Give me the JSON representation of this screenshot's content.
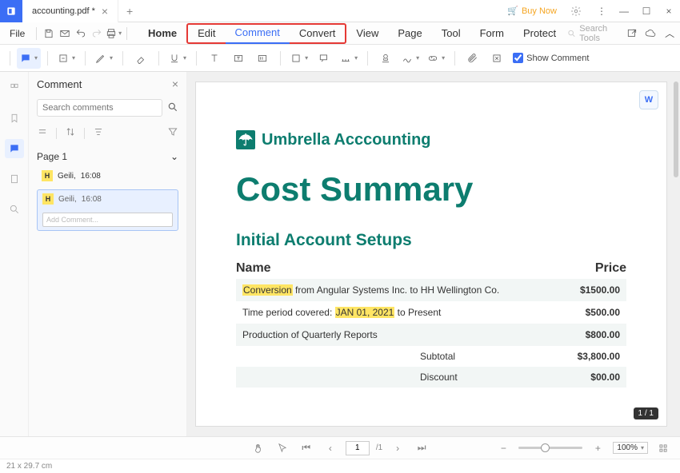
{
  "titlebar": {
    "filename": "accounting.pdf *",
    "buy_now": "Buy Now"
  },
  "menubar": {
    "file": "File",
    "tabs": [
      "Home",
      "Edit",
      "Comment",
      "Convert",
      "View",
      "Page",
      "Tool",
      "Form",
      "Protect"
    ],
    "search_placeholder": "Search Tools"
  },
  "toolbar": {
    "show_comment": "Show Comment"
  },
  "panel": {
    "title": "Comment",
    "search_placeholder": "Search comments",
    "page_label": "Page 1",
    "items": [
      {
        "author": "Geili,",
        "time": "16:08"
      },
      {
        "author": "Geili,",
        "time": "16:08"
      }
    ],
    "add_placeholder": "Add Comment..."
  },
  "document": {
    "brand": "Umbrella Acccounting",
    "title": "Cost Summary",
    "subtitle": "Initial Account Setups",
    "col_name": "Name",
    "col_price": "Price",
    "rows": [
      {
        "pre": "Conversion",
        "rest": " from Angular Systems Inc. to HH Wellington Co.",
        "price": "$1500.00"
      },
      {
        "pre2": "Time period covered: ",
        "mid": "JAN 01, 2021",
        "rest": " to Present",
        "price": "$500.00"
      },
      {
        "name": "Production of Quarterly Reports",
        "price": "$800.00"
      }
    ],
    "subtotal_label": "Subtotal",
    "subtotal": "$3,800.00",
    "discount_label": "Discount",
    "discount": "$00.00",
    "page_badge": "1 / 1"
  },
  "bottombar": {
    "page_current": "1",
    "page_total": "/1",
    "zoom": "100%"
  },
  "statusbar": {
    "dims": "21 x 29.7 cm"
  }
}
